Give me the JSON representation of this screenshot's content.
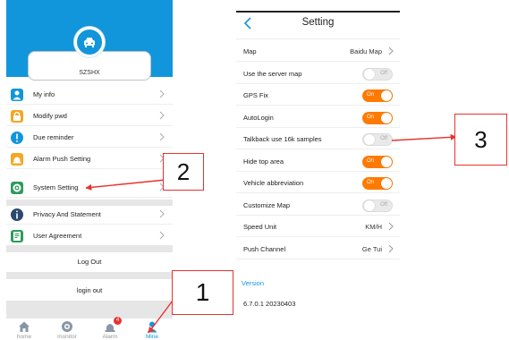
{
  "left_phone": {
    "username": "SZSHX",
    "menu": [
      {
        "label": "My info",
        "icon": "person-icon",
        "color": "#1296db"
      },
      {
        "label": "Modify pwd",
        "icon": "lock-icon",
        "color": "#f5a623"
      },
      {
        "label": "Due reminder",
        "icon": "exclamation-icon",
        "color": "#1296db"
      },
      {
        "label": "Alarm Push Setting",
        "icon": "alarm-icon",
        "color": "#f5a623"
      },
      {
        "label": "System Setting",
        "icon": "gear-icon",
        "color": "#2e9b5b"
      },
      {
        "label": "Privacy And Statement",
        "icon": "info-icon",
        "color": "#2c4a6e"
      },
      {
        "label": "User Agreement",
        "icon": "document-icon",
        "color": "#2e9b5b"
      }
    ],
    "log_out_label": "Log Out",
    "login_out_label": "login out",
    "tabs": [
      {
        "label": "home",
        "icon": "home-icon"
      },
      {
        "label": "monitor",
        "icon": "eye-icon"
      },
      {
        "label": "Alarm",
        "icon": "alarm-icon",
        "badge": "4"
      },
      {
        "label": "Mine",
        "icon": "person-icon",
        "active": true
      }
    ]
  },
  "right_phone": {
    "title": "Setting",
    "rows": [
      {
        "label": "Map",
        "value": "Baidu Map",
        "type": "link"
      },
      {
        "label": "Use the server map",
        "toggle": "Off",
        "type": "toggle"
      },
      {
        "label": "GPS Fix",
        "toggle": "On",
        "type": "toggle"
      },
      {
        "label": "AutoLogin",
        "toggle": "On",
        "type": "toggle"
      },
      {
        "label": "Talkback use 16k samples",
        "toggle": "Off",
        "type": "toggle"
      },
      {
        "label": "Hide top area",
        "toggle": "On",
        "type": "toggle"
      },
      {
        "label": "Vehicle abbreviation",
        "toggle": "On",
        "type": "toggle"
      },
      {
        "label": "Customize Map",
        "toggle": "Off",
        "type": "toggle"
      },
      {
        "label": "Speed Unit",
        "value": "KM/H",
        "type": "link"
      },
      {
        "label": "Push Channel",
        "value": "Ge Tui",
        "type": "link"
      }
    ],
    "version_label": "Version",
    "version_value": "6.7.0.1 20230403"
  },
  "annotations": [
    "1",
    "2",
    "3"
  ],
  "colors": {
    "accent": "#1296db",
    "toggle_on": "#ff7a00",
    "annotation": "#e8322f"
  }
}
